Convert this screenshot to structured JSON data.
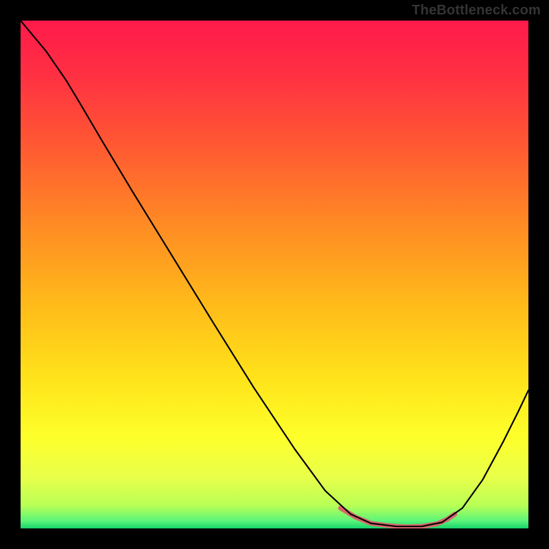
{
  "watermark": "TheBottleneck.com",
  "gradient": {
    "stops": [
      {
        "offset": 0.0,
        "color": "#ff1a4a"
      },
      {
        "offset": 0.1,
        "color": "#ff2e43"
      },
      {
        "offset": 0.25,
        "color": "#ff5a32"
      },
      {
        "offset": 0.4,
        "color": "#ff8a24"
      },
      {
        "offset": 0.55,
        "color": "#ffb81a"
      },
      {
        "offset": 0.7,
        "color": "#ffe21a"
      },
      {
        "offset": 0.82,
        "color": "#feff2a"
      },
      {
        "offset": 0.9,
        "color": "#e8ff4a"
      },
      {
        "offset": 0.955,
        "color": "#b8ff55"
      },
      {
        "offset": 0.985,
        "color": "#5cf57a"
      },
      {
        "offset": 1.0,
        "color": "#17d36b"
      }
    ]
  },
  "chart_data": {
    "type": "line",
    "series": [
      {
        "name": "curve",
        "stroke": "#000000",
        "width": 2.2,
        "points": [
          {
            "x": 0.0,
            "y": 1.0
          },
          {
            "x": 0.05,
            "y": 0.94
          },
          {
            "x": 0.09,
            "y": 0.882
          },
          {
            "x": 0.12,
            "y": 0.832
          },
          {
            "x": 0.16,
            "y": 0.764
          },
          {
            "x": 0.22,
            "y": 0.664
          },
          {
            "x": 0.3,
            "y": 0.534
          },
          {
            "x": 0.38,
            "y": 0.404
          },
          {
            "x": 0.46,
            "y": 0.276
          },
          {
            "x": 0.54,
            "y": 0.156
          },
          {
            "x": 0.6,
            "y": 0.074
          },
          {
            "x": 0.65,
            "y": 0.028
          },
          {
            "x": 0.69,
            "y": 0.01
          },
          {
            "x": 0.74,
            "y": 0.004
          },
          {
            "x": 0.79,
            "y": 0.004
          },
          {
            "x": 0.83,
            "y": 0.012
          },
          {
            "x": 0.87,
            "y": 0.04
          },
          {
            "x": 0.91,
            "y": 0.096
          },
          {
            "x": 0.95,
            "y": 0.17
          },
          {
            "x": 0.98,
            "y": 0.23
          },
          {
            "x": 1.0,
            "y": 0.272
          }
        ]
      },
      {
        "name": "highlight",
        "stroke": "#d9676b",
        "width": 7.0,
        "points": [
          {
            "x": 0.63,
            "y": 0.04
          },
          {
            "x": 0.66,
            "y": 0.022
          },
          {
            "x": 0.68,
            "y": 0.014
          },
          {
            "x": 0.69,
            "y": 0.01
          },
          {
            "x": 0.72,
            "y": 0.006
          },
          {
            "x": 0.74,
            "y": 0.004
          },
          {
            "x": 0.76,
            "y": 0.003
          },
          {
            "x": 0.79,
            "y": 0.004
          },
          {
            "x": 0.82,
            "y": 0.009
          },
          {
            "x": 0.84,
            "y": 0.018
          },
          {
            "x": 0.855,
            "y": 0.028
          }
        ]
      }
    ],
    "xlim": [
      0,
      1
    ],
    "ylim": [
      0,
      1
    ],
    "title": "",
    "xlabel": "",
    "ylabel": ""
  }
}
